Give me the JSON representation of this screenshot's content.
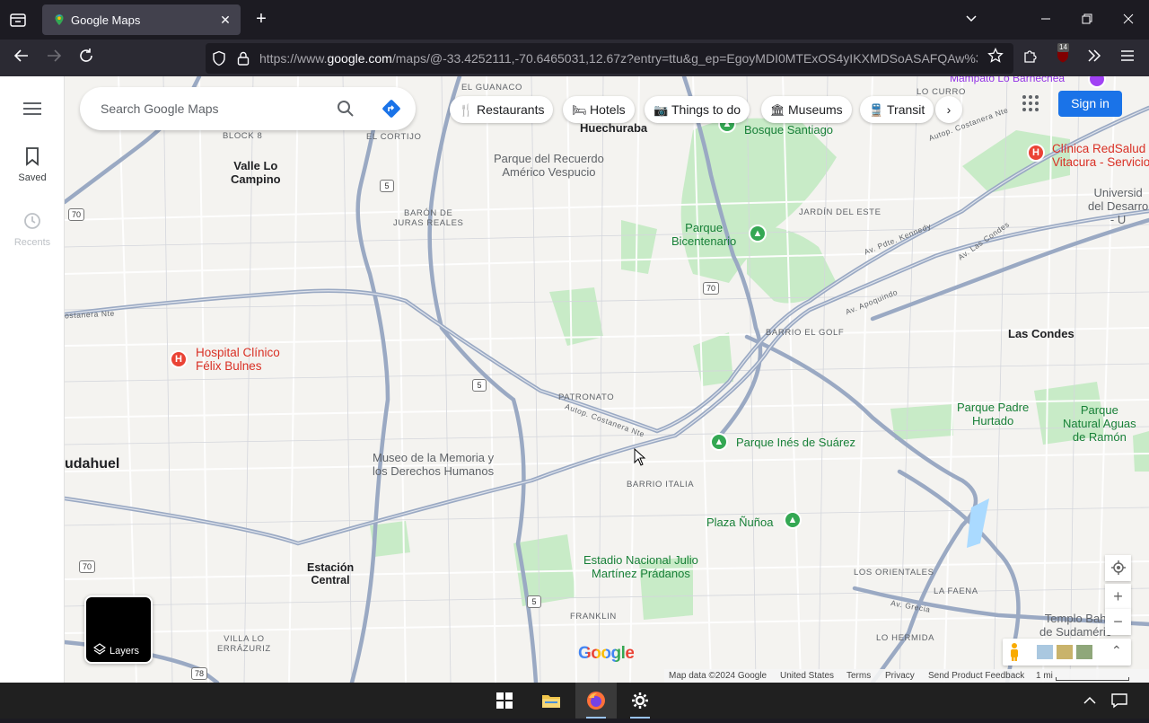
{
  "browser": {
    "tab": {
      "title": "Google Maps"
    },
    "url": {
      "prefix": "https://www.",
      "domain": "google.com",
      "rest": "/maps/@-33.4252111,-70.6465031,12.67z?entry=ttu&g_ep=EgoyMDI0MTExOS4yIKXMDSoASAFQAw%3"
    },
    "extension_badge": "14"
  },
  "sidebar": {
    "items": [
      {
        "label": "Saved"
      },
      {
        "label": "Recents"
      }
    ]
  },
  "search": {
    "placeholder": "Search Google Maps"
  },
  "chips": [
    {
      "label": "Restaurants",
      "icon": "fork-knife-icon"
    },
    {
      "label": "Hotels",
      "icon": "bed-icon"
    },
    {
      "label": "Things to do",
      "icon": "camera-icon"
    },
    {
      "label": "Museums",
      "icon": "museum-icon"
    },
    {
      "label": "Transit",
      "icon": "train-icon"
    }
  ],
  "header": {
    "signin": "Sign in"
  },
  "map": {
    "labels": {
      "el_guanaco": "EL GUANACO",
      "huechuraba": "Huechuraba",
      "lo_curro": "LO CURRO",
      "mampato": "Mampato Lo Barnechea",
      "bosque_santiago": "Bosque Santiago",
      "block8": "BLOCK 8",
      "el_cortijo": "EL CORTIJO",
      "valle_lo_campino_1": "Valle Lo",
      "valle_lo_campino_2": "Campino",
      "parque_recuerdo_1": "Parque del Recuerdo",
      "parque_recuerdo_2": "Américo Vespucio",
      "clinica_1": "Clínica RedSalud",
      "clinica_2": "Vitacura - Servicio",
      "universidad_1": "Universid",
      "universidad_2": "del Desarro",
      "universidad_3": "- U",
      "baron_1": "BARÓN DE",
      "baron_2": "JURAS REALES",
      "jardin_del_este": "JARDÍN DEL ESTE",
      "parque_bicentenario_1": "Parque",
      "parque_bicentenario_2": "Bicentenario",
      "barrio_el_golf": "BARRIO EL GOLF",
      "las_condes": "Las Condes",
      "hospital_1": "Hospital Clínico",
      "hospital_2": "Félix Bulnes",
      "patronato": "PATRONATO",
      "parque_padre_1": "Parque Padre",
      "parque_padre_2": "Hurtado",
      "parque_aguas_1": "Parque",
      "parque_aguas_2": "Natural Aguas",
      "parque_aguas_3": "de Ramón",
      "pudahuel": "udahuel",
      "museo_1": "Museo de la Memoria y",
      "museo_2": "los Derechos Humanos",
      "parque_ines": "Parque Inés de Suárez",
      "barrio_italia": "BARRIO ITALIA",
      "plaza_nunoa": "Plaza Ñuñoa",
      "estacion_1": "Estación",
      "estacion_2": "Central",
      "estadio_1": "Estadio Nacional Julio",
      "estadio_2": "Martínez Prádanos",
      "los_orientales": "LOS ORIENTALES",
      "la_faena": "LA FAENA",
      "franklin": "FRANKLIN",
      "templo_1": "Templo Bah",
      "templo_2": "de Sudaméric",
      "villa_1": "VILLA LO",
      "villa_2": "ERRÁZURIZ",
      "lo_hermida": "LO HERMIDA",
      "costanera_1": "Autop. Costanera Nte",
      "costanera_2": "Autop. Costanera Nte",
      "costanera_3": "Autop. Costanera Nte",
      "costanera_w": "ostanera Nte",
      "kennedy": "Av. Pdte. Kennedy",
      "apoquindo": "Av. Apoquindo",
      "las_condes_av": "Av. Las Condes",
      "grecia": "Av. Grecia"
    },
    "shields": [
      "70",
      "5",
      "5",
      "70",
      "5",
      "70",
      "78"
    ],
    "layers_label": "Layers",
    "google_logo": "Google",
    "footer": {
      "map_data": "Map data ©2024 Google",
      "region": "United States",
      "terms": "Terms",
      "privacy": "Privacy",
      "feedback": "Send Product Feedback",
      "scale": "1 mi"
    }
  },
  "colors": {
    "accent": "#1a73e8",
    "park": "#c8ebc7",
    "road": "#9aa9c3",
    "hospital": "#ea4335",
    "parkpin": "#34a853"
  }
}
